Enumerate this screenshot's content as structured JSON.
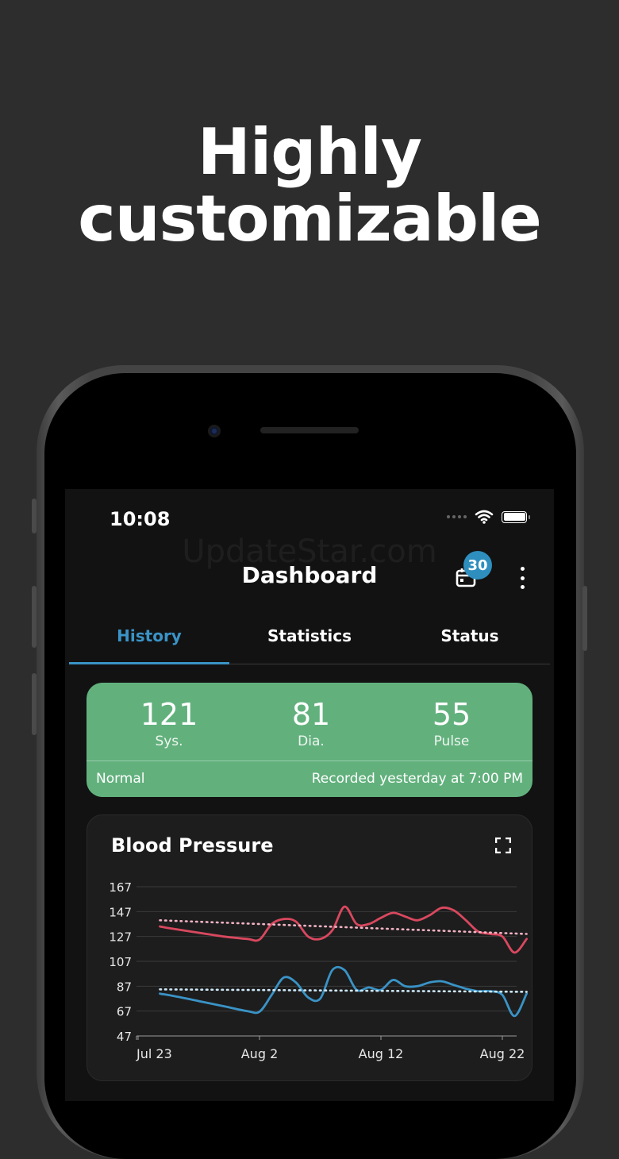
{
  "headline": {
    "line1": "Highly",
    "line2": "customizable"
  },
  "status_bar": {
    "time": "10:08"
  },
  "watermark": "UpdateStar.com",
  "app_bar": {
    "title": "Dashboard",
    "calendar_badge": "30",
    "calendar_icon": "calendar-icon",
    "menu_icon": "more-vertical-icon"
  },
  "tabs": [
    {
      "label": "History",
      "active": true
    },
    {
      "label": "Statistics",
      "active": false
    },
    {
      "label": "Status",
      "active": false
    }
  ],
  "summary": {
    "systolic": {
      "value": "121",
      "label": "Sys."
    },
    "diastolic": {
      "value": "81",
      "label": "Dia."
    },
    "pulse": {
      "value": "55",
      "label": "Pulse"
    },
    "status": "Normal",
    "recorded": "Recorded yesterday at 7:00 PM",
    "color": "#62b17d"
  },
  "chart_card": {
    "title": "Blood Pressure",
    "expand_icon": "expand-icon"
  },
  "chart_data": {
    "type": "line",
    "title": "Blood Pressure",
    "ylim": [
      47,
      167
    ],
    "yticks": [
      167,
      147,
      127,
      107,
      87,
      67,
      47
    ],
    "x_domain": [
      0,
      30
    ],
    "xticks": [
      {
        "label": "Jul 23",
        "day": 0
      },
      {
        "label": "Aug 2",
        "day": 10
      },
      {
        "label": "Aug 12",
        "day": 20
      },
      {
        "label": "Aug 22",
        "day": 30
      }
    ],
    "grid": true,
    "series": [
      {
        "color": "#d9485f",
        "values": [
          [
            1.8,
            135
          ],
          [
            3,
            133
          ],
          [
            5,
            130
          ],
          [
            7,
            127
          ],
          [
            9,
            125
          ],
          [
            10,
            124.5
          ],
          [
            11,
            137
          ],
          [
            12,
            141
          ],
          [
            13,
            139
          ],
          [
            14,
            127
          ],
          [
            15,
            125
          ],
          [
            16,
            132
          ],
          [
            17,
            151
          ],
          [
            18,
            137
          ],
          [
            19,
            137
          ],
          [
            20,
            142
          ],
          [
            21,
            146
          ],
          [
            22,
            143
          ],
          [
            23,
            140
          ],
          [
            24,
            144
          ],
          [
            25,
            150
          ],
          [
            26,
            148
          ],
          [
            27,
            140
          ],
          [
            28,
            131
          ],
          [
            29,
            129
          ],
          [
            30,
            127
          ],
          [
            31,
            114
          ],
          [
            32,
            125
          ]
        ]
      },
      {
        "color": "#3a93c6",
        "values": [
          [
            1.8,
            81
          ],
          [
            3,
            79
          ],
          [
            5,
            75
          ],
          [
            7,
            71
          ],
          [
            9,
            67
          ],
          [
            10,
            66.5
          ],
          [
            11,
            80
          ],
          [
            12,
            94
          ],
          [
            13,
            90
          ],
          [
            14,
            78
          ],
          [
            15,
            77
          ],
          [
            16,
            100
          ],
          [
            17,
            100
          ],
          [
            18,
            84
          ],
          [
            19,
            86
          ],
          [
            20,
            84
          ],
          [
            21,
            92
          ],
          [
            22,
            87
          ],
          [
            23,
            87
          ],
          [
            24,
            90
          ],
          [
            25,
            91
          ],
          [
            26,
            88
          ],
          [
            27,
            85
          ],
          [
            28,
            83
          ],
          [
            29,
            83
          ],
          [
            30,
            80
          ],
          [
            31,
            63
          ],
          [
            32,
            81
          ]
        ]
      },
      {
        "color": "#f2b3c4",
        "dotted": true,
        "values": [
          [
            1.8,
            140
          ],
          [
            32,
            129
          ]
        ]
      },
      {
        "color": "#cde7f7",
        "dotted": true,
        "values": [
          [
            1.8,
            84.5
          ],
          [
            32,
            82.5
          ]
        ]
      }
    ]
  }
}
